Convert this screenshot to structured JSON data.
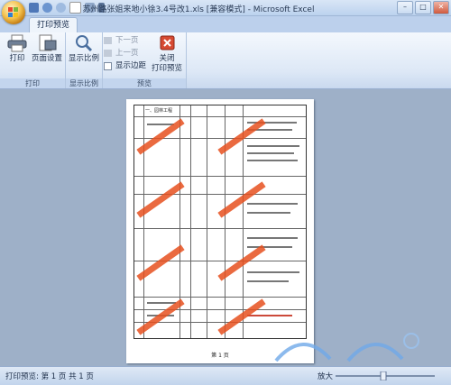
{
  "window": {
    "title": "苏州路张姐来地小徐3.4号改1.xls  [兼容模式]  - Microsoft Excel",
    "controls": [
      "–",
      "□",
      "✕"
    ]
  },
  "tabs": [
    {
      "label": "打印预览",
      "active": true
    }
  ],
  "ribbon": {
    "groups": [
      {
        "label": "打印",
        "buttons": [
          {
            "label": "打印",
            "icon": "printer-icon"
          },
          {
            "label": "页面设置",
            "icon": "page-setup-icon"
          }
        ]
      },
      {
        "label": "显示比例",
        "buttons": [
          {
            "label": "显示比例",
            "icon": "zoom-icon"
          }
        ]
      },
      {
        "label": "预览",
        "buttons": [
          {
            "label": "下一页",
            "icon": "next-page-icon",
            "enabled": false
          },
          {
            "label": "上一页",
            "icon": "prev-page-icon",
            "enabled": false
          },
          {
            "label": "显示边距",
            "icon": "checkbox-icon",
            "checked": false
          },
          {
            "label": "关闭\n打印预览",
            "icon": "close-preview-icon"
          }
        ]
      }
    ]
  },
  "preview": {
    "footer": "第 1 页",
    "header_cell": "一、园林工程"
  },
  "status": {
    "left": "打印预览: 第 1 页  共 1 页",
    "zoom_label": "放大"
  },
  "colors": {
    "accent": "#d93218",
    "ribbon": "#dde8f6",
    "workspace": "#9eb0c8"
  }
}
